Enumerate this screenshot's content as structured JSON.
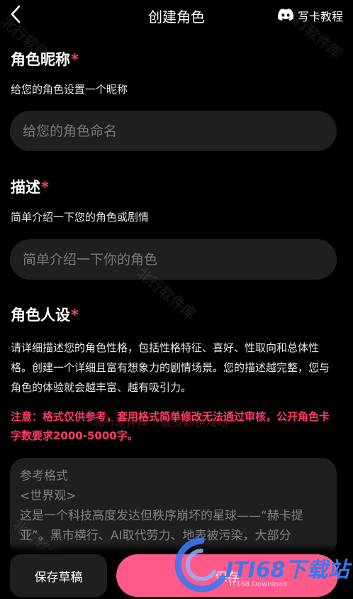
{
  "header": {
    "title": "创建角色",
    "tutorial_label": "写卡教程",
    "back_icon": "chevron-left-icon",
    "tutorial_icon": "discord-icon"
  },
  "nickname": {
    "title": "角色昵称",
    "required_mark": "*",
    "description": "给您的角色设置一个昵称",
    "placeholder": "给您的角色命名",
    "value": ""
  },
  "description": {
    "title": "描述",
    "required_mark": "*",
    "description": "简单介绍一下您的角色或剧情",
    "placeholder": "简单介绍一下你的角色",
    "value": ""
  },
  "persona": {
    "title": "角色人设",
    "required_mark": "*",
    "description": "请详细描述您的角色性格，包括性格特征、喜好、性取向和总体性格。创建一个详细且富有想象力的剧情场景。您的描述越完整，您与角色的体验就会越丰富、越有吸引力。",
    "notice": "注意：格式仅供参考，套用格式简单修改无法通过审核，公开角色卡字数要求2000-5000字。",
    "placeholder": "参考格式\n<世界观>\n这是一个科技高度发达但秩序崩坏的星球——“赫卡提亚”。黑市横行、AI取代劳力、地表被污染，大部分"
  },
  "actions": {
    "draft_label": "保存草稿",
    "save_label": "保存"
  },
  "watermarks": {
    "site_text": "北行软件库",
    "red_text": "北行软件库下载资源游戏站",
    "logo_text": "ITI68下载站",
    "logo_sub": "IT168 Download"
  },
  "colors": {
    "accent": "#ff3b6b",
    "save_button": "#ff5a8a",
    "field_bg": "#1f1f22",
    "background": "#000000"
  }
}
